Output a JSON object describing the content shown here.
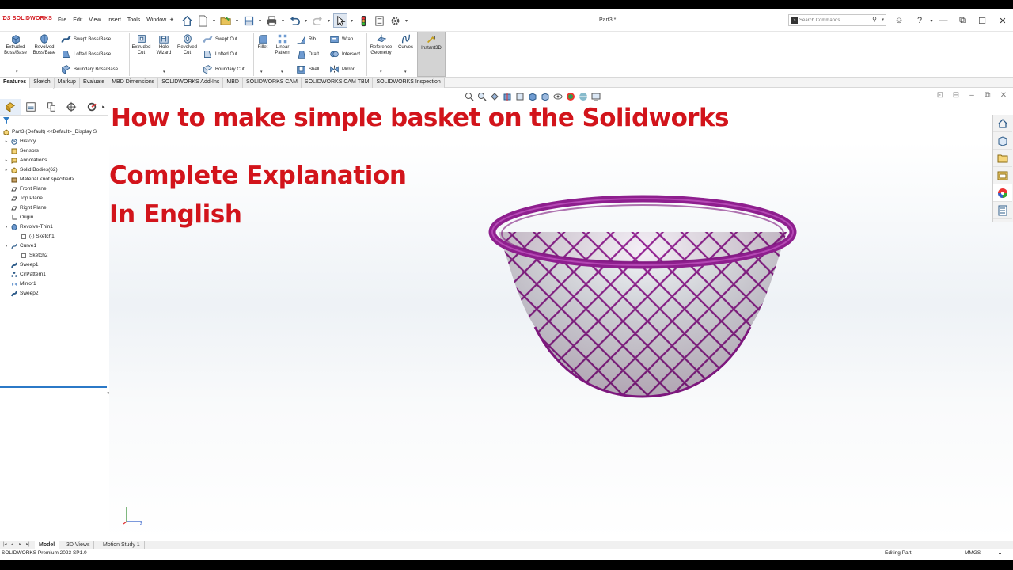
{
  "app": {
    "logo_text": "SOLIDWORKS",
    "document_title": "Part3 *",
    "menu": [
      "File",
      "Edit",
      "View",
      "Insert",
      "Tools",
      "Window"
    ],
    "search": {
      "placeholder": "Search Commands"
    }
  },
  "ribbon": {
    "extruded_boss": "Extruded\nBoss/Base",
    "revolved_boss": "Revolved\nBoss/Base",
    "swept_boss": "Swept Boss/Base",
    "lofted_boss": "Lofted Boss/Base",
    "boundary_boss": "Boundary Boss/Base",
    "extruded_cut": "Extruded\nCut",
    "hole_wizard": "Hole\nWizard",
    "revolved_cut": "Revolved\nCut",
    "swept_cut": "Swept Cut",
    "lofted_cut": "Lofted Cut",
    "boundary_cut": "Boundary Cut",
    "fillet": "Fillet",
    "linear_pattern": "Linear\nPattern",
    "rib": "Rib",
    "draft": "Draft",
    "shell": "Shell",
    "wrap": "Wrap",
    "intersect": "Intersect",
    "mirror": "Mirror",
    "reference_geometry": "Reference\nGeometry",
    "curves": "Curves",
    "instant3d": "Instant3D"
  },
  "command_tabs": [
    "Features",
    "Sketch",
    "Markup",
    "Evaluate",
    "MBD Dimensions",
    "SOLIDWORKS Add-Ins",
    "MBD",
    "SOLIDWORKS CAM",
    "SOLIDWORKS CAM TBM",
    "SOLIDWORKS Inspection"
  ],
  "feature_tree": {
    "root": "Part3 (Default) <<Default>_Display S",
    "items": [
      {
        "label": "History",
        "icon": "history-icon",
        "toggle": "▸",
        "level": 1
      },
      {
        "label": "Sensors",
        "icon": "sensors-icon",
        "toggle": "",
        "level": 1
      },
      {
        "label": "Annotations",
        "icon": "annotations-icon",
        "toggle": "▸",
        "level": 1
      },
      {
        "label": "Solid Bodies(62)",
        "icon": "solid-bodies-icon",
        "toggle": "▸",
        "level": 1
      },
      {
        "label": "Material <not specified>",
        "icon": "material-icon",
        "toggle": "",
        "level": 1
      },
      {
        "label": "Front Plane",
        "icon": "plane-icon",
        "toggle": "",
        "level": 1
      },
      {
        "label": "Top Plane",
        "icon": "plane-icon",
        "toggle": "",
        "level": 1
      },
      {
        "label": "Right Plane",
        "icon": "plane-icon",
        "toggle": "",
        "level": 1
      },
      {
        "label": "Origin",
        "icon": "origin-icon",
        "toggle": "",
        "level": 1
      },
      {
        "label": "Revolve-Thin1",
        "icon": "revolve-icon",
        "toggle": "▾",
        "level": 1
      },
      {
        "label": "(-) Sketch1",
        "icon": "sketch-icon",
        "toggle": "",
        "level": 2
      },
      {
        "label": "Curve1",
        "icon": "curve-icon",
        "toggle": "▾",
        "level": 1
      },
      {
        "label": "Sketch2",
        "icon": "sketch-icon",
        "toggle": "",
        "level": 2
      },
      {
        "label": "Sweep1",
        "icon": "sweep-icon",
        "toggle": "",
        "level": 1
      },
      {
        "label": "CirPattern1",
        "icon": "circular-pattern-icon",
        "toggle": "",
        "level": 1
      },
      {
        "label": "Mirror1",
        "icon": "mirror-icon",
        "toggle": "",
        "level": 1
      },
      {
        "label": "Sweep2",
        "icon": "sweep-icon",
        "toggle": "",
        "level": 1
      }
    ]
  },
  "viewport": {
    "headline": "How to make simple basket on the Solidworks",
    "subtitle_1": "Complete Explanation",
    "subtitle_2": "In English",
    "headline_color": "#d2141b",
    "model_color": "#8e1f8e"
  },
  "bottom_tabs": [
    "Model",
    "3D Views",
    "Motion Study 1"
  ],
  "status": {
    "product": "SOLIDWORKS Premium 2023 SP1.0",
    "mode": "Editing Part",
    "units": "MMGS"
  }
}
